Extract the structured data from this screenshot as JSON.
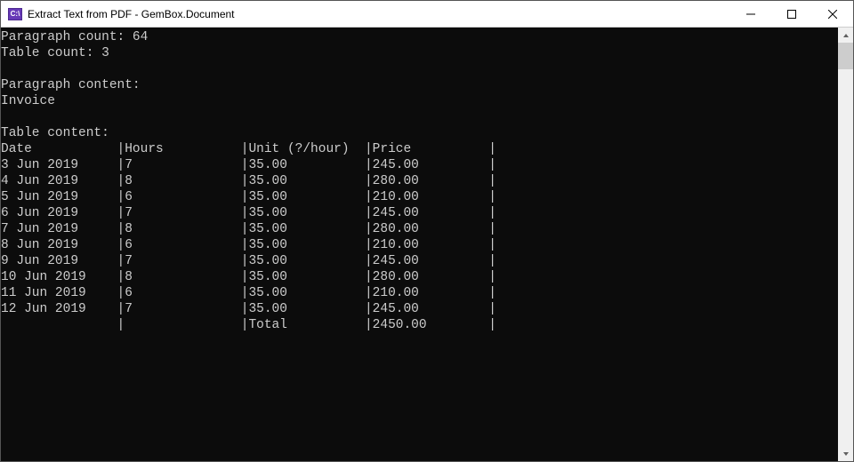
{
  "window": {
    "icon_text": "C:\\",
    "title": "Extract Text from PDF - GemBox.Document"
  },
  "console": {
    "paragraph_count_label": "Paragraph count: ",
    "paragraph_count": "64",
    "table_count_label": "Table count: ",
    "table_count": "3",
    "paragraph_content_label": "Paragraph content:",
    "paragraph_content_value": "Invoice",
    "table_content_label": "Table content:",
    "headers": [
      "Date",
      "Hours",
      "Unit (?/hour)",
      "Price"
    ],
    "rows": [
      {
        "date": "3 Jun 2019",
        "hours": "7",
        "unit": "35.00",
        "price": "245.00"
      },
      {
        "date": "4 Jun 2019",
        "hours": "8",
        "unit": "35.00",
        "price": "280.00"
      },
      {
        "date": "5 Jun 2019",
        "hours": "6",
        "unit": "35.00",
        "price": "210.00"
      },
      {
        "date": "6 Jun 2019",
        "hours": "7",
        "unit": "35.00",
        "price": "245.00"
      },
      {
        "date": "7 Jun 2019",
        "hours": "8",
        "unit": "35.00",
        "price": "280.00"
      },
      {
        "date": "8 Jun 2019",
        "hours": "6",
        "unit": "35.00",
        "price": "210.00"
      },
      {
        "date": "9 Jun 2019",
        "hours": "7",
        "unit": "35.00",
        "price": "245.00"
      },
      {
        "date": "10 Jun 2019",
        "hours": "8",
        "unit": "35.00",
        "price": "280.00"
      },
      {
        "date": "11 Jun 2019",
        "hours": "6",
        "unit": "35.00",
        "price": "210.00"
      },
      {
        "date": "12 Jun 2019",
        "hours": "7",
        "unit": "35.00",
        "price": "245.00"
      }
    ],
    "total_label": "Total",
    "total_value": "2450.00"
  },
  "col_widths": {
    "date": 15,
    "hours": 15,
    "unit": 15,
    "price": 15
  }
}
